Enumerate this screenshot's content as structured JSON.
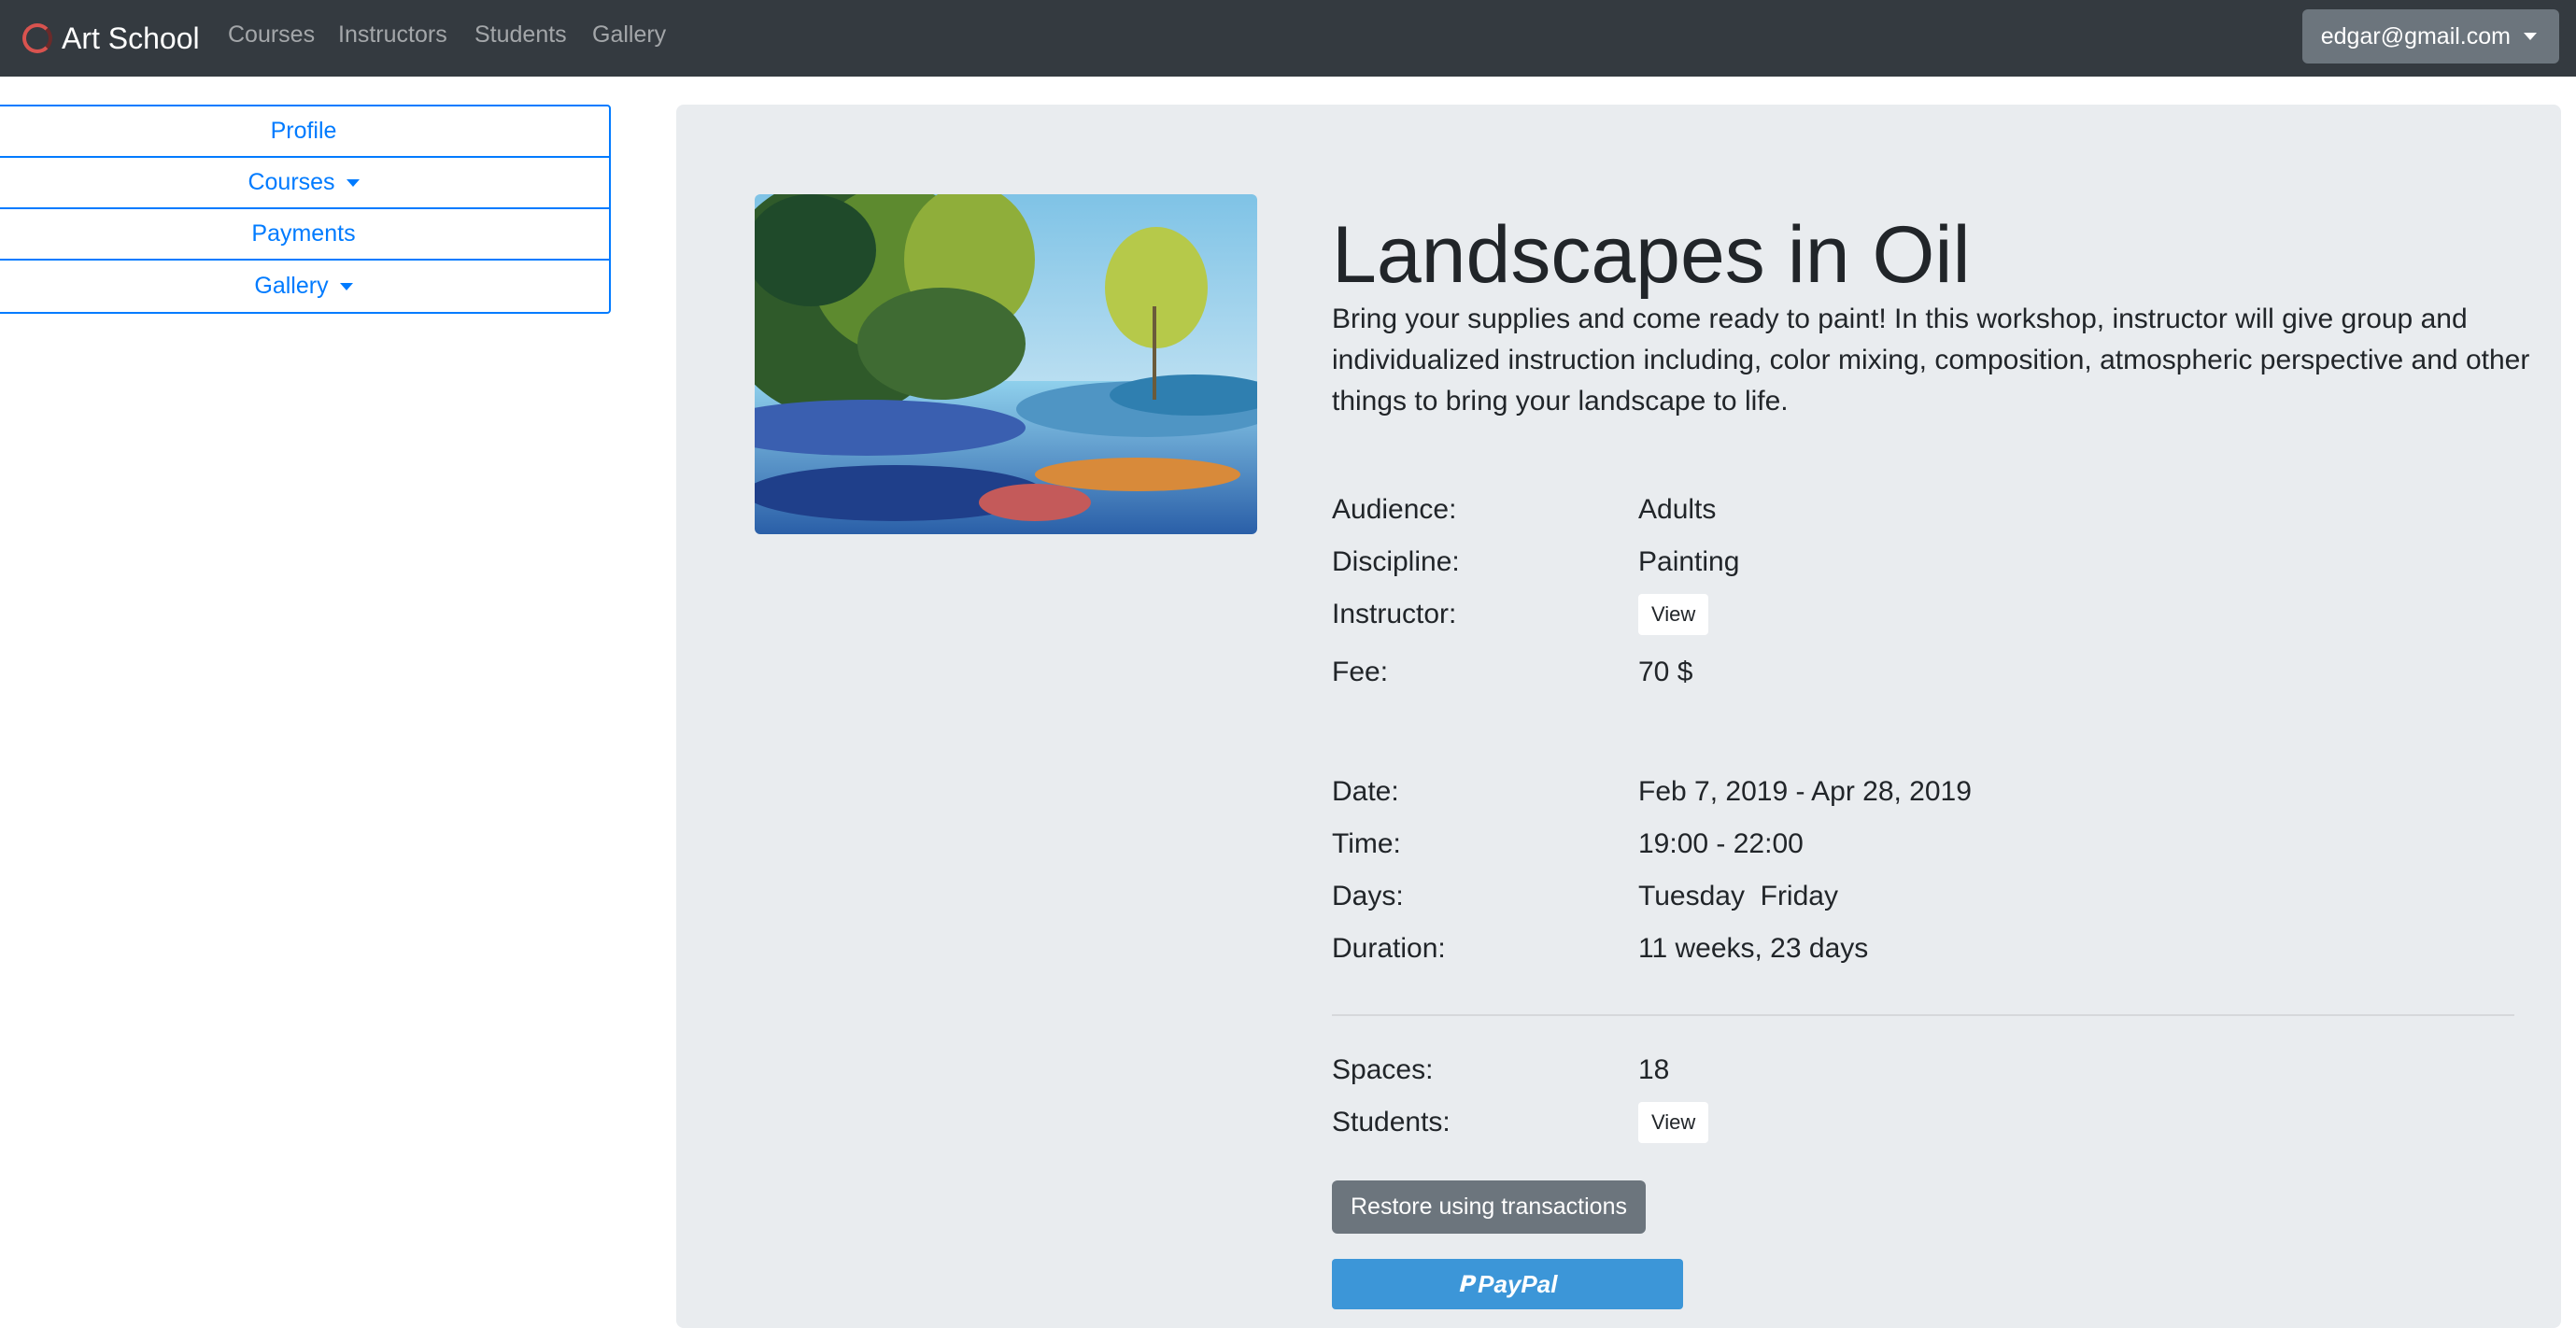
{
  "navbar": {
    "brand": "Art School",
    "links": [
      "Courses",
      "Instructors",
      "Students",
      "Gallery"
    ],
    "user": "edgar@gmail.com"
  },
  "sidebar": {
    "items": [
      {
        "label": "Profile",
        "dropdown": false
      },
      {
        "label": "Courses",
        "dropdown": true
      },
      {
        "label": "Payments",
        "dropdown": false
      },
      {
        "label": "Gallery",
        "dropdown": true
      }
    ]
  },
  "course": {
    "title": "Landscapes in Oil",
    "description": "Bring your supplies and come ready to paint! In this workshop, instructor will give group and individualized instruction including, color mixing, composition, atmospheric perspective and other things to bring your landscape to life.",
    "image_alt": "landscape-oil-painting",
    "audience_label": "Audience:",
    "audience": "Adults",
    "discipline_label": "Discipline:",
    "discipline": "Painting",
    "instructor_label": "Instructor:",
    "instructor_button": "View",
    "fee_label": "Fee:",
    "fee": "70 $",
    "date_label": "Date:",
    "date": "Feb 7, 2019 - Apr 28, 2019",
    "time_label": "Time:",
    "time": "19:00 - 22:00",
    "days_label": "Days:",
    "days": "Tuesday  Friday",
    "duration_label": "Duration:",
    "duration": "11 weeks, 23 days",
    "spaces_label": "Spaces:",
    "spaces": "18",
    "students_label": "Students:",
    "students_button": "View",
    "restore_button": "Restore using transactions",
    "paypal_button": "PayPal"
  },
  "colors": {
    "navbar": "#343a40",
    "primary": "#007bff",
    "jumbotron": "#e9ecef",
    "secondary": "#6c757d",
    "paypal": "#3c96d8"
  }
}
